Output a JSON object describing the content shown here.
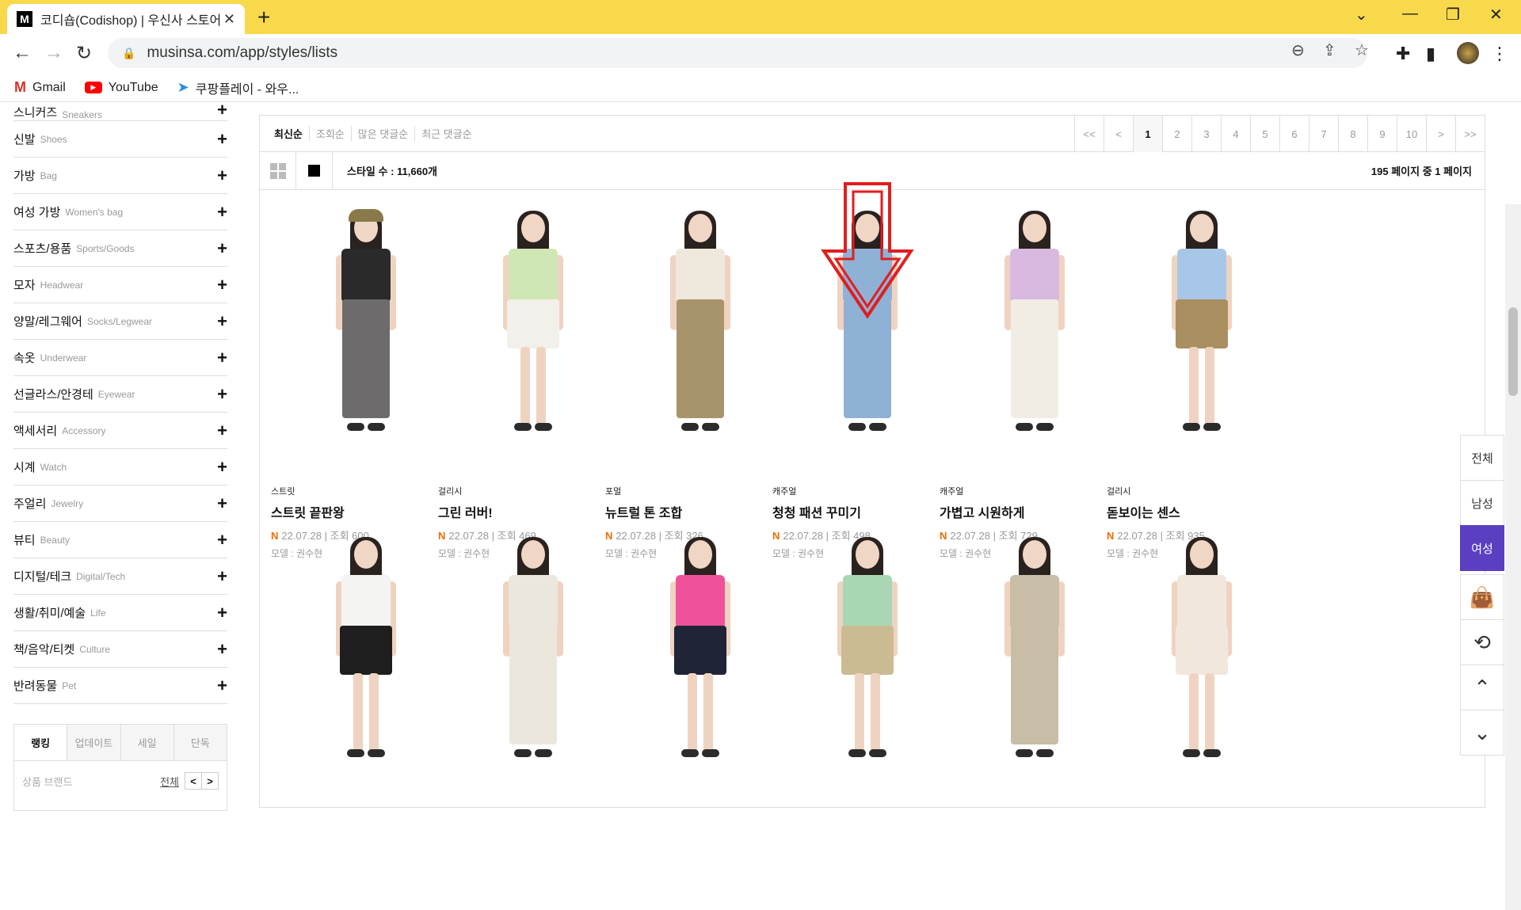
{
  "browser": {
    "tab_title": "코디숍(Codishop) | 우신사 스토어",
    "favicon": "M",
    "url": "musinsa.com/app/styles/lists",
    "bookmarks": [
      {
        "label": "Gmail",
        "icon": "gmail-icon"
      },
      {
        "label": "YouTube",
        "icon": "youtube-icon"
      },
      {
        "label": "쿠팡플레이 - 와우...",
        "icon": "coupangplay-icon"
      }
    ]
  },
  "sidebar": {
    "top_partial": {
      "ko": "스니커즈",
      "en": "Sneakers"
    },
    "categories": [
      {
        "ko": "신발",
        "en": "Shoes"
      },
      {
        "ko": "가방",
        "en": "Bag"
      },
      {
        "ko": "여성 가방",
        "en": "Women's bag"
      },
      {
        "ko": "스포츠/용품",
        "en": "Sports/Goods"
      },
      {
        "ko": "모자",
        "en": "Headwear"
      },
      {
        "ko": "양말/레그웨어",
        "en": "Socks/Legwear"
      },
      {
        "ko": "속옷",
        "en": "Underwear"
      },
      {
        "ko": "선글라스/안경테",
        "en": "Eyewear"
      },
      {
        "ko": "액세서리",
        "en": "Accessory"
      },
      {
        "ko": "시계",
        "en": "Watch"
      },
      {
        "ko": "주얼리",
        "en": "Jewelry"
      },
      {
        "ko": "뷰티",
        "en": "Beauty"
      },
      {
        "ko": "디지털/테크",
        "en": "Digital/Tech"
      },
      {
        "ko": "생활/취미/예술",
        "en": "Life"
      },
      {
        "ko": "책/음악/티켓",
        "en": "Culture"
      },
      {
        "ko": "반려동물",
        "en": "Pet"
      }
    ],
    "ranking": {
      "tabs": [
        "랭킹",
        "업데이트",
        "세일",
        "단독"
      ],
      "sub": "상품  브랜드",
      "all": "전체",
      "prev": "<",
      "next": ">"
    }
  },
  "main": {
    "sorts": [
      "최신순",
      "조회순",
      "많은 댓글순",
      "최근 댓글순"
    ],
    "pager": [
      "<<",
      "<",
      "1",
      "2",
      "3",
      "4",
      "5",
      "6",
      "7",
      "8",
      "9",
      "10",
      ">",
      ">>"
    ],
    "current_page": "1",
    "style_count": "스타일 수 : 11,660개",
    "page_info": "195 페이지 중 1 페이지",
    "cards": [
      {
        "tag": "스트릿",
        "title": "스트릿 끝판왕",
        "date": "22.07.28",
        "views": "조회 600",
        "model": "모델 : 권수현",
        "top": "#2a2a2a",
        "bottom": "#6d6b6b",
        "hat": "#8a7a4a"
      },
      {
        "tag": "걸리시",
        "title": "그린 러버!",
        "date": "22.07.28",
        "views": "조회 469",
        "model": "모델 : 권수현",
        "top": "#cfe6b5",
        "bottom": "#f2f0ea"
      },
      {
        "tag": "포멀",
        "title": "뉴트럴 톤 조합",
        "date": "22.07.28",
        "views": "조회 326",
        "model": "모델 : 권수현",
        "top": "#efe9dd",
        "bottom": "#a8946a"
      },
      {
        "tag": "캐주얼",
        "title": "청청 패션 꾸미기",
        "date": "22.07.28",
        "views": "조회 498",
        "model": "모델 : 권수현",
        "top": "#8fb1d6",
        "bottom": "#8fb1d6"
      },
      {
        "tag": "캐주얼",
        "title": "가볍고 시원하게",
        "date": "22.07.28",
        "views": "조회 729",
        "model": "모델 : 권수현",
        "top": "#d9b9e0",
        "bottom": "#f1ede4"
      },
      {
        "tag": "걸리시",
        "title": "돋보이는 센스",
        "date": "22.07.28",
        "views": "조회 935",
        "model": "모델 : 권수현",
        "top": "#a8c7e8",
        "bottom": "#a98e60"
      }
    ],
    "cards_row2": [
      {
        "top": "#f4f4f2",
        "bottom": "#1e1e1e"
      },
      {
        "top": "#ebe7dd",
        "bottom": "#ebe7dd"
      },
      {
        "top": "#f0529a",
        "bottom": "#1f2436"
      },
      {
        "top": "#a9d6b4",
        "bottom": "#cbbb93"
      },
      {
        "top": "#c8bda6",
        "bottom": "#c8bda6"
      },
      {
        "top": "#f2e7dd",
        "bottom": "#f2e7dd"
      }
    ],
    "new_badge": "N"
  },
  "float_menu": {
    "items": [
      "전체",
      "남성",
      "여성"
    ],
    "active": "여성",
    "icons": [
      "shopping-bag-icon",
      "share-icon",
      "scroll-top-icon",
      "scroll-down-icon"
    ]
  },
  "colors": {
    "accent": "#5a3fc0",
    "tabstrip": "#f8d94c",
    "arrow": "#e01e1e"
  }
}
